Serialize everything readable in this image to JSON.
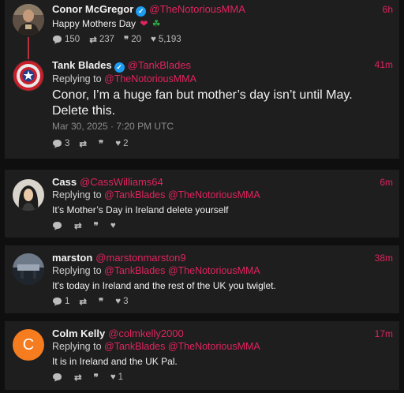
{
  "posts": {
    "conor": {
      "name": "Conor McGregor",
      "handle": "@TheNotoriousMMA",
      "time": "6h",
      "text": "Happy Mothers Day",
      "emoji_heart": "❤",
      "emoji_shamrock": "☘",
      "stats": {
        "replies": "150",
        "retweets": "237",
        "quotes": "20",
        "likes": "5,193"
      }
    },
    "tank": {
      "name": "Tank Blades",
      "handle": "@TankBlades",
      "time": "41m",
      "replying_label": "Replying to",
      "replying_to": "@TheNotoriousMMA",
      "text": "Conor, I’m a huge fan but mother’s day isn’t until May. Delete this.",
      "timestamp": "Mar 30, 2025 · 7:20 PM UTC",
      "stats": {
        "replies": "3",
        "retweets": "",
        "quotes": "",
        "likes": "2"
      }
    }
  },
  "replies": [
    {
      "name": "Cass",
      "handle": "@CassWilliams64",
      "time": "6m",
      "replying_label": "Replying to",
      "replying_to_1": "@TankBlades",
      "replying_to_2": "@TheNotoriousMMA",
      "text": "It’s Mother’s Day in Ireland  delete yourself",
      "stats": {
        "replies": "",
        "retweets": "",
        "quotes": "",
        "likes": ""
      }
    },
    {
      "name": "marston",
      "handle": "@marstonmarston9",
      "time": "38m",
      "replying_label": "Replying to",
      "replying_to_1": "@TankBlades",
      "replying_to_2": "@TheNotoriousMMA",
      "text": "It's today in Ireland and the rest of the UK you twiglet.",
      "stats": {
        "replies": "1",
        "retweets": "",
        "quotes": "",
        "likes": "3"
      }
    },
    {
      "name": "Colm Kelly",
      "handle": "@colmkelly2000",
      "time": "17m",
      "replying_label": "Replying to",
      "replying_to_1": "@TankBlades",
      "replying_to_2": "@TheNotoriousMMA",
      "avatar_letter": "C",
      "text": "It is in Ireland and the UK Pal.",
      "stats": {
        "replies": "",
        "retweets": "",
        "quotes": "",
        "likes": "1"
      }
    }
  ],
  "colors": {
    "background": "#0f0f0f",
    "card": "#1e1e1e",
    "accent": "#e0245e",
    "verified": "#1d9bf0",
    "thread_line": "#b73339",
    "colm_avatar": "#f57c1f"
  }
}
